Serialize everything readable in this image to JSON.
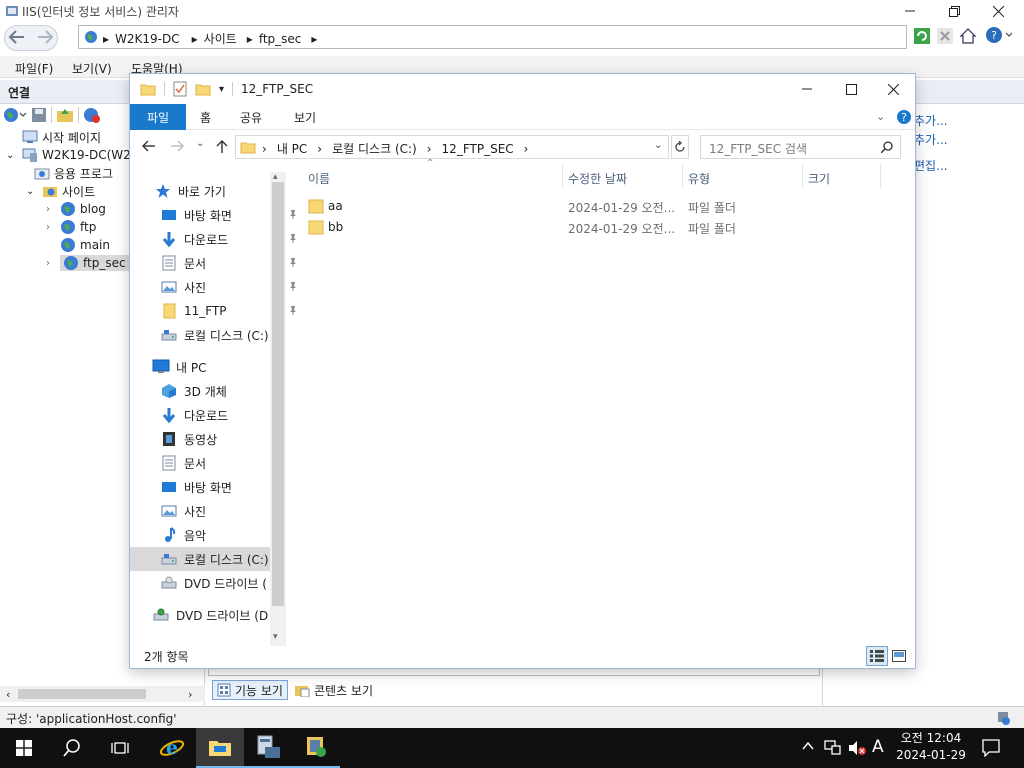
{
  "iis": {
    "title": "IIS(인터넷 정보 서비스) 관리자",
    "breadcrumb": [
      "W2K19-DC",
      "사이트",
      "ftp_sec"
    ],
    "menu": [
      "파일(F)",
      "보기(V)",
      "도움말(H)"
    ],
    "connections_header": "연결",
    "tree": {
      "start_page": "시작 페이지",
      "server": "W2K19-DC(W2",
      "app_pools": "응용 프로그",
      "sites": "사이트",
      "site_items": [
        "blog",
        "ftp",
        "main",
        "ftp_sec"
      ]
    },
    "right_links": [
      "추가...",
      "추가...",
      "편집..."
    ],
    "bottom_tabs": [
      "기능 보기",
      "콘텐츠 보기"
    ],
    "status": "구성: 'applicationHost.config'"
  },
  "explorer": {
    "title": "12_FTP_SEC",
    "ribbon_tabs": [
      "파일",
      "홈",
      "공유",
      "보기"
    ],
    "path": [
      "내 PC",
      "로컬 디스크 (C:)",
      "12_FTP_SEC"
    ],
    "search_placeholder": "12_FTP_SEC 검색",
    "nav": {
      "quick_access": "바로 가기",
      "quick_items": [
        "바탕 화면",
        "다운로드",
        "문서",
        "사진",
        "11_FTP",
        "로컬 디스크 (C:)"
      ],
      "this_pc": "내 PC",
      "pc_items": [
        "3D 개체",
        "다운로드",
        "동영상",
        "문서",
        "바탕 화면",
        "사진",
        "음악",
        "로컬 디스크 (C:)",
        "DVD 드라이브 ("
      ],
      "dvd": "DVD 드라이브 (D"
    },
    "columns": [
      "이름",
      "수정한 날짜",
      "유형",
      "크기"
    ],
    "files": [
      {
        "name": "aa",
        "date": "2024-01-29 오전...",
        "type": "파일 폴더"
      },
      {
        "name": "bb",
        "date": "2024-01-29 오전...",
        "type": "파일 폴더"
      }
    ],
    "status_count": "2개 항목"
  },
  "taskbar": {
    "time": "오전 12:04",
    "date": "2024-01-29",
    "ime": "A"
  },
  "colors": {
    "accent": "#1979ca",
    "folder": "#f8d775",
    "taskbar": "#101010"
  }
}
